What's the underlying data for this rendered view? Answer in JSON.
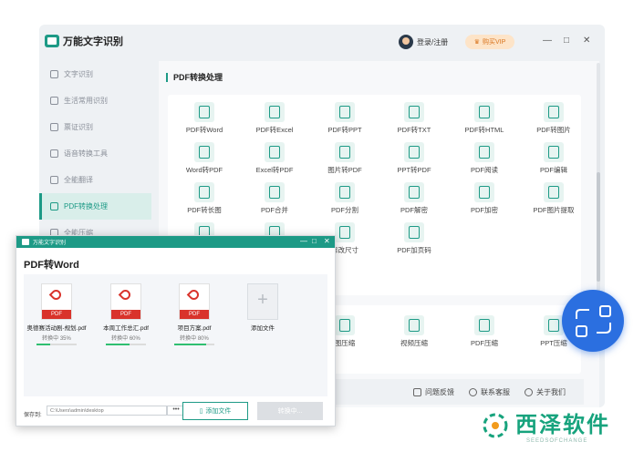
{
  "app": {
    "title": "万能文字识别"
  },
  "sidebar": {
    "items": [
      {
        "label": "文字识别"
      },
      {
        "label": "生活常用识别"
      },
      {
        "label": "票证识别"
      },
      {
        "label": "语音转换工具"
      },
      {
        "label": "全能翻译"
      },
      {
        "label": "PDF转换处理"
      },
      {
        "label": "全能压缩"
      }
    ],
    "active_index": 5
  },
  "header": {
    "login_label": "登录/注册",
    "vip_label": "购买VIP",
    "minimize": "—",
    "maximize": "□",
    "close": "✕"
  },
  "main": {
    "section_title": "PDF转换处理",
    "tools": [
      "PDF转Word",
      "PDF转Excel",
      "PDF转PPT",
      "PDF转TXT",
      "PDF转HTML",
      "PDF转图片",
      "Word转PDF",
      "Excel转PDF",
      "图片转PDF",
      "PPT转PDF",
      "PDF阅读",
      "PDF编辑",
      "PDF转长图",
      "PDF合并",
      "PDF分割",
      "PDF解密",
      "PDF加密",
      "PDF图片提取",
      "",
      "",
      "修改尺寸",
      "PDF加页码"
    ],
    "compress_tools": [
      "",
      "图压缩",
      "视频压缩",
      "PDF压缩",
      "PPT压缩"
    ]
  },
  "footer": {
    "feedback": "问题反馈",
    "service": "联系客服",
    "about": "关于我们"
  },
  "dialog": {
    "window_title": "万能文字识别",
    "title": "PDF转Word",
    "files": [
      {
        "name": "奥德赛活动剧-规划.pdf",
        "status": "转换中 35%",
        "progress": 0.35
      },
      {
        "name": "本周工作总汇.pdf",
        "status": "转换中 60%",
        "progress": 0.6
      },
      {
        "name": "项目方案.pdf",
        "status": "转换中 80%",
        "progress": 0.8
      }
    ],
    "pdf_tag": "PDF",
    "add_file_label": "添加文件",
    "save_label": "保存到:",
    "save_path": "C:\\Users\\admin\\desktop",
    "dots": "•••",
    "btn_add": "添加文件",
    "btn_start": "转换中..."
  },
  "watermark": {
    "name": "西泽软件",
    "sub": "SEEDSOFCHANGE"
  },
  "colors": {
    "accent": "#1d9a86",
    "pdf_red": "#d9332b",
    "float_blue": "#2b6fe0",
    "progress": "#2fbf71"
  }
}
